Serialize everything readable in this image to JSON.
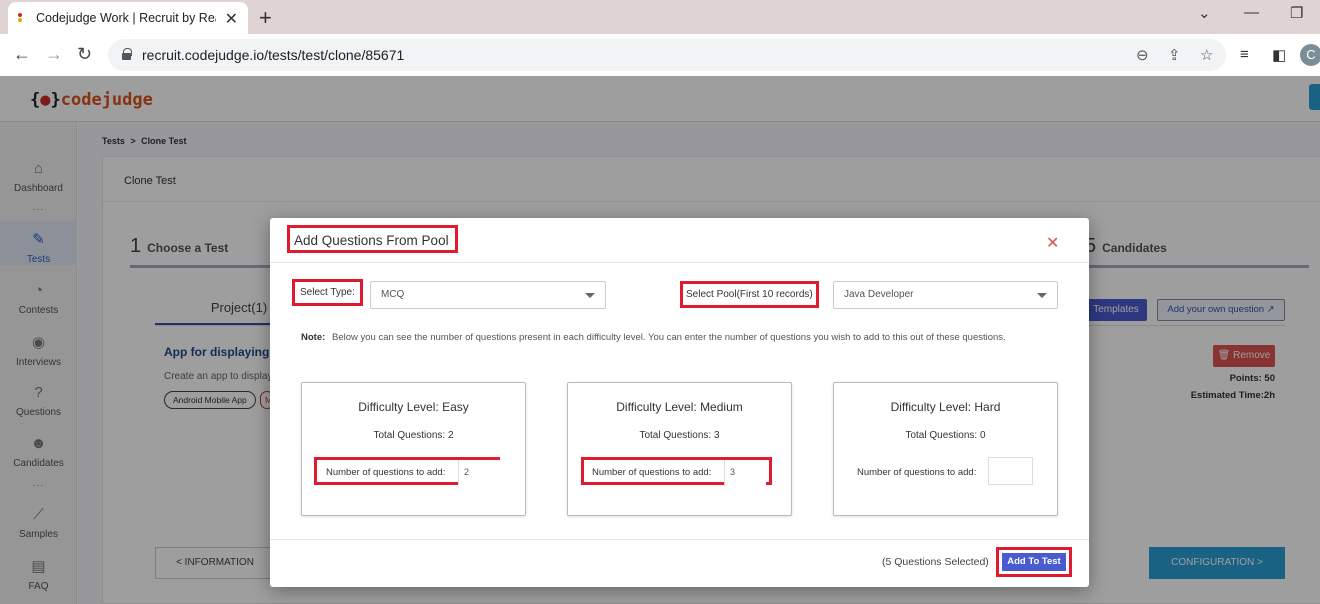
{
  "browser": {
    "tab_title": "Codejudge Work | Recruit by Rea",
    "url": "recruit.codejudge.io/tests/test/clone/85671",
    "profile_initial": "C"
  },
  "app": {
    "logo_brace_open": "{",
    "logo_brace_close": "}",
    "logo_text": "codejudge",
    "sidebar": [
      {
        "label": "Dashboard",
        "icon": "home-icon"
      },
      {
        "label": "Tests",
        "icon": "pencil-icon"
      },
      {
        "label": "Contests",
        "icon": "pie-chart-icon"
      },
      {
        "label": "Interviews",
        "icon": "podcast-icon"
      },
      {
        "label": "Questions",
        "icon": "question-circle-icon"
      },
      {
        "label": "Candidates",
        "icon": "users-icon"
      },
      {
        "label": "Samples",
        "icon": "line-chart-icon"
      },
      {
        "label": "FAQ",
        "icon": "chat-icon"
      }
    ],
    "sidebar_dots": "...",
    "breadcrumb": {
      "first": "Tests",
      "sep": ">",
      "second": "Clone Test"
    },
    "card_title": "Clone Test",
    "steps": [
      {
        "num": "1",
        "label": "Choose a Test"
      },
      {
        "num": "5",
        "label": "Candidates"
      }
    ],
    "project_tab": "Project(1)",
    "project_title": "App for displaying re",
    "project_desc": "Create an app to display",
    "chips": [
      "Android Mobile App",
      "M"
    ],
    "templates_btn": "Templates",
    "add_own_btn": "Add your own question",
    "remove_btn": "Remove",
    "points": "Points: 50",
    "estimated_time": "Estimated Time:2h",
    "info_btn": "< INFORMATION",
    "config_btn": "CONFIGURATION >"
  },
  "modal": {
    "title": "Add Questions From Pool",
    "select_type_label": "Select Type:",
    "select_type_value": "MCQ",
    "select_pool_label": "Select Pool(First 10 records)",
    "select_pool_value": "Java Developer",
    "note_label": "Note:",
    "note_text": "Below you can see the number of questions present in each difficulty level. You can enter the number of questions you wish to add to this out of these questions.",
    "levels": [
      {
        "title": "Difficulty Level: Easy",
        "total": "Total Questions: 2",
        "input_label": "Number of questions to add:",
        "input_value": "2"
      },
      {
        "title": "Difficulty Level: Medium",
        "total": "Total Questions: 3",
        "input_label": "Number of questions to add:",
        "input_value": "3"
      },
      {
        "title": "Difficulty Level: Hard",
        "total": "Total Questions: 0",
        "input_label": "Number of questions to add:",
        "input_value": ""
      }
    ],
    "selected_text": "(5 Questions Selected)",
    "add_button": "Add To Test",
    "highlight_color": "#e01b2f",
    "accent_color": "#4a5bd0"
  }
}
